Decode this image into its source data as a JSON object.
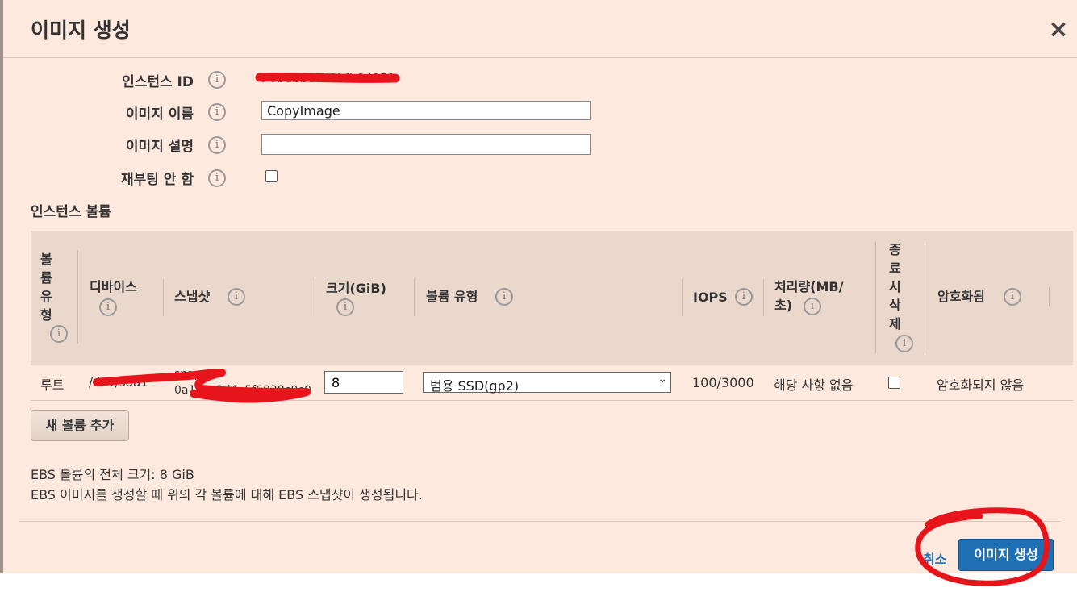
{
  "dialog": {
    "title": "이미지 생성",
    "close_glyph": "×"
  },
  "form": {
    "instance_id_label": "인스턴스 ID",
    "instance_id_value": "i-0bdbbc0b1bfb9425f",
    "image_name_label": "이미지 이름",
    "image_name_value": "CopyImage",
    "image_desc_label": "이미지 설명",
    "image_desc_value": "",
    "no_reboot_label": "재부팅 안 함",
    "no_reboot_checked": false
  },
  "volumes": {
    "section_title": "인스턴스 볼륨",
    "headers": {
      "volume_type": "볼\n륨\n유\n형",
      "device": "디바이스",
      "snapshot": "스냅샷",
      "size": "크기(GiB)",
      "vol_kind": "볼륨 유형",
      "iops": "IOPS",
      "throughput": "처리량(MB/\n초)",
      "delete_on_term": "종\n료\n시\n삭\n제",
      "encrypted": "암호화됨"
    },
    "rows": [
      {
        "volume_type": "루트",
        "device": "/dev/sda1",
        "snapshot_line1": "snap-",
        "snapshot_line2": "0a1b2c3d4e5f6028c0c0",
        "size": "8",
        "vol_kind": "범용 SSD(gp2)",
        "iops": "100/3000",
        "throughput": "해당 사항 없음",
        "delete_on_term": false,
        "encrypted": "암호화되지 않음"
      }
    ],
    "add_button": "새 볼륨 추가"
  },
  "summary": {
    "total_size": "EBS 볼륨의 전체 크기: 8 GiB",
    "note": "EBS 이미지를 생성할 때 위의 각 볼륨에 대해 EBS 스냅샷이 생성됩니다."
  },
  "footer": {
    "cancel": "취소",
    "create": "이미지 생성"
  },
  "icons": {
    "info": "i"
  },
  "colors": {
    "background": "#fde9de",
    "primary_button": "#1f6fb5",
    "annotation_red": "#e8141b"
  }
}
